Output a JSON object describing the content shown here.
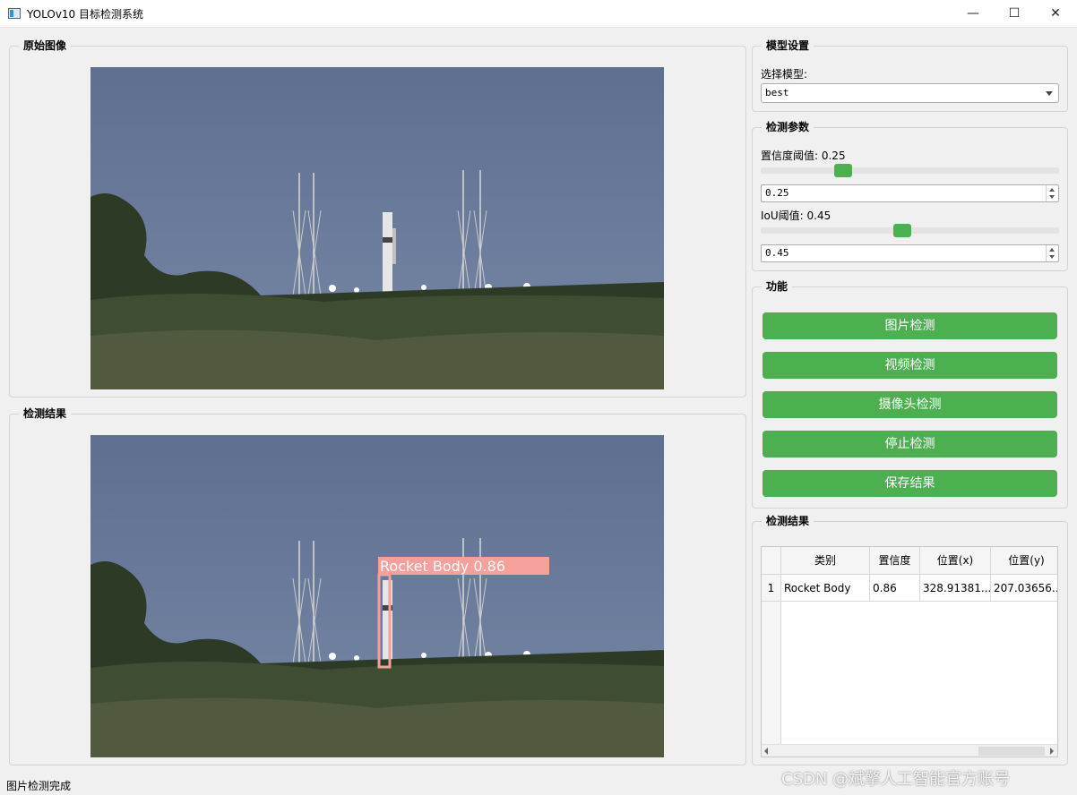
{
  "window": {
    "title": "YOLOv10 目标检测系统",
    "minimize": "—",
    "maximize": "☐",
    "close": "✕"
  },
  "original": {
    "title": "原始图像"
  },
  "result_image": {
    "title": "检测结果",
    "box_label": "Rocket Body 0.86"
  },
  "model": {
    "title": "模型设置",
    "select_label": "选择模型:",
    "selected": "best"
  },
  "params": {
    "title": "检测参数",
    "conf_label": "置信度阈值: 0.25",
    "conf_value": "0.25",
    "conf_level": 0.25,
    "iou_label": "IoU阈值: 0.45",
    "iou_value": "0.45",
    "iou_level": 0.45
  },
  "functions": {
    "title": "功能",
    "buttons": [
      "图片检测",
      "视频检测",
      "摄像头检测",
      "停止检测",
      "保存结果"
    ]
  },
  "results_table": {
    "title": "检测结果",
    "headers": [
      "类别",
      "置信度",
      "位置(x)",
      "位置(y)"
    ],
    "rows": [
      {
        "index": "1",
        "cls": "Rocket Body",
        "conf": "0.86",
        "x": "328.91381...",
        "y": "207.03656..."
      }
    ]
  },
  "status": "图片检测完成",
  "watermark": "CSDN @斌擎人工智能官方账号",
  "colors": {
    "accent_green": "#4caf50",
    "box_color": "#f4a09b",
    "sky": "#6a7d9d"
  }
}
